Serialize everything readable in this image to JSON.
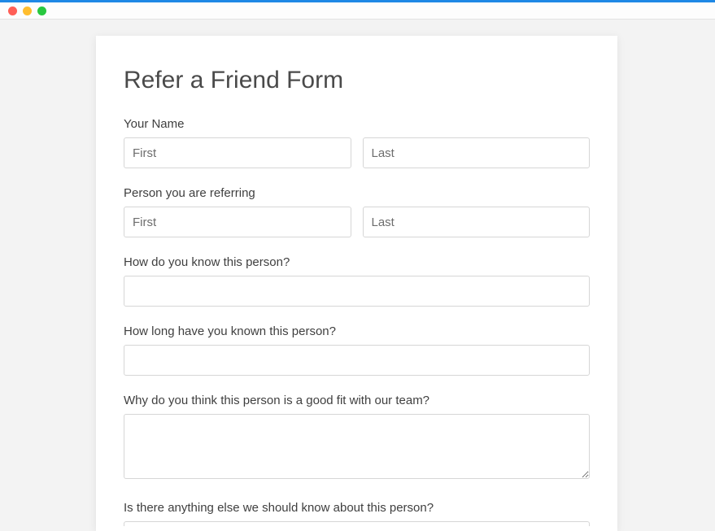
{
  "window": {
    "traffic_lights": [
      "close",
      "minimize",
      "zoom"
    ]
  },
  "form": {
    "title": "Refer a Friend Form",
    "your_name": {
      "label": "Your Name",
      "first_placeholder": "First",
      "last_placeholder": "Last",
      "first_value": "",
      "last_value": ""
    },
    "referral_name": {
      "label": "Person you are referring",
      "first_placeholder": "First",
      "last_placeholder": "Last",
      "first_value": "",
      "last_value": ""
    },
    "how_know": {
      "label": "How do you know this person?",
      "value": ""
    },
    "how_long": {
      "label": "How long have you known this person?",
      "value": ""
    },
    "good_fit": {
      "label": "Why do you think this person is a good fit with our team?",
      "value": ""
    },
    "anything_else": {
      "label": "Is there anything else we should know about this person?",
      "value": ""
    }
  }
}
